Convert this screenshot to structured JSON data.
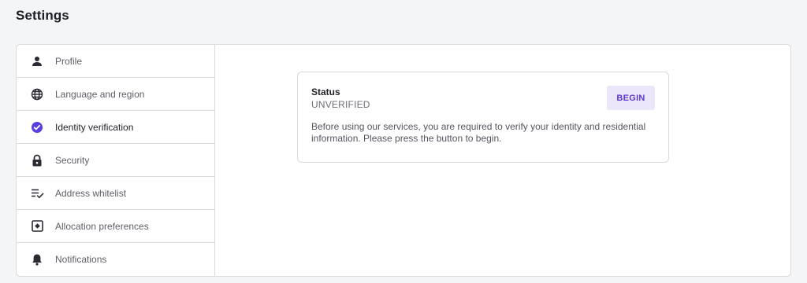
{
  "page": {
    "title": "Settings"
  },
  "colors": {
    "accent": "#5b3bcc",
    "accent_bg": "#ece6fb",
    "verified_icon": "#5a3ee0"
  },
  "sidebar": {
    "items": [
      {
        "label": "Profile",
        "icon": "person-icon"
      },
      {
        "label": "Language and region",
        "icon": "globe-icon"
      },
      {
        "label": "Identity verification",
        "icon": "check-badge-icon",
        "active": true
      },
      {
        "label": "Security",
        "icon": "lock-icon"
      },
      {
        "label": "Address whitelist",
        "icon": "list-check-icon"
      },
      {
        "label": "Allocation preferences",
        "icon": "allocation-icon"
      },
      {
        "label": "Notifications",
        "icon": "bell-icon"
      }
    ]
  },
  "card": {
    "status_label": "Status",
    "status_value": "UNVERIFIED",
    "begin_label": "BEGIN",
    "description": "Before using our services, you are required to verify your identity and residential information. Please press the button to begin."
  }
}
